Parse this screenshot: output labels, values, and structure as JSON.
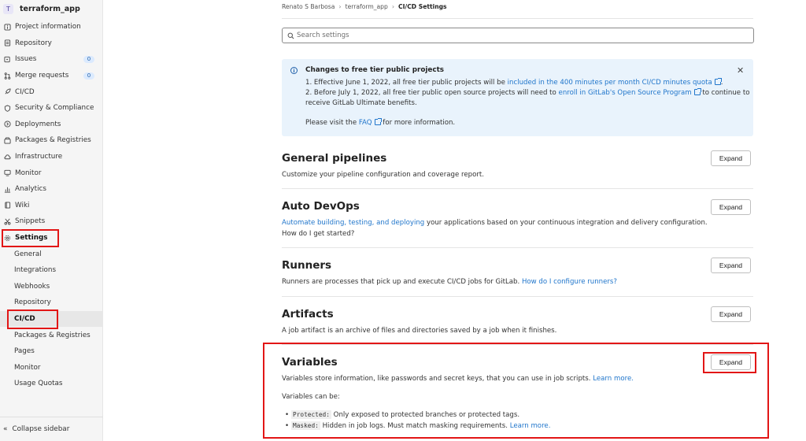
{
  "project": {
    "avatar": "T",
    "name": "terraform_app"
  },
  "sidebar": {
    "items": [
      {
        "label": "Project information",
        "icon": "info-square-icon"
      },
      {
        "label": "Repository",
        "icon": "document-icon"
      },
      {
        "label": "Issues",
        "icon": "issues-icon",
        "badge": "0"
      },
      {
        "label": "Merge requests",
        "icon": "merge-request-icon",
        "badge": "0"
      },
      {
        "label": "CI/CD",
        "icon": "rocket-icon"
      },
      {
        "label": "Security & Compliance",
        "icon": "shield-icon"
      },
      {
        "label": "Deployments",
        "icon": "deployments-icon"
      },
      {
        "label": "Packages & Registries",
        "icon": "package-icon"
      },
      {
        "label": "Infrastructure",
        "icon": "cloud-icon"
      },
      {
        "label": "Monitor",
        "icon": "monitor-icon"
      },
      {
        "label": "Analytics",
        "icon": "chart-icon"
      },
      {
        "label": "Wiki",
        "icon": "book-icon"
      },
      {
        "label": "Snippets",
        "icon": "scissors-icon"
      },
      {
        "label": "Settings",
        "icon": "gear-icon"
      }
    ],
    "settings_sub": [
      "General",
      "Integrations",
      "Webhooks",
      "Repository",
      "CI/CD",
      "Packages & Registries",
      "Pages",
      "Monitor",
      "Usage Quotas"
    ],
    "collapse_label": "Collapse sidebar"
  },
  "breadcrumb": {
    "user": "Renato S Barbosa",
    "project": "terraform_app",
    "current": "CI/CD Settings"
  },
  "search": {
    "placeholder": "Search settings"
  },
  "alert": {
    "title": "Changes to free tier public projects",
    "line1_pre": "1. Effective June 1, 2022, all free tier public projects will be ",
    "line1_link": "included in the 400 minutes per month CI/CD minutes quota",
    "line1_post": ".",
    "line2_pre": "2. Before July 1, 2022, all free tier public open source projects will need to ",
    "line2_link": "enroll in GitLab's Open Source Program",
    "line2_post": " to continue to",
    "line3": "receive GitLab Ultimate benefits.",
    "faq_pre": "Please visit the ",
    "faq_link": "FAQ",
    "faq_post": " for more information."
  },
  "sections": {
    "general": {
      "title": "General pipelines",
      "desc": "Customize your pipeline configuration and coverage report.",
      "button": "Expand"
    },
    "autodevops": {
      "title": "Auto DevOps",
      "desc_link": "Automate building, testing, and deploying",
      "desc_post": " your applications based on your continuous integration and delivery configuration.",
      "help_link": "How do I get started?",
      "button": "Expand"
    },
    "runners": {
      "title": "Runners",
      "desc": "Runners are processes that pick up and execute CI/CD jobs for GitLab. ",
      "help_link": "How do I configure runners?",
      "button": "Expand"
    },
    "artifacts": {
      "title": "Artifacts",
      "desc": "A job artifact is an archive of files and directories saved by a job when it finishes.",
      "button": "Expand"
    },
    "variables": {
      "title": "Variables",
      "desc": "Variables store information, like passwords and secret keys, that you can use in job scripts. ",
      "learn_more": "Learn more.",
      "can_be": "Variables can be:",
      "b1_code": "Protected:",
      "b1_text": " Only exposed to protected branches or protected tags.",
      "b2_code": "Masked:",
      "b2_text": " Hidden in job logs. Must match masking requirements. ",
      "b2_link": "Learn more.",
      "button": "Expand"
    }
  },
  "highlight_color": "#e21616"
}
